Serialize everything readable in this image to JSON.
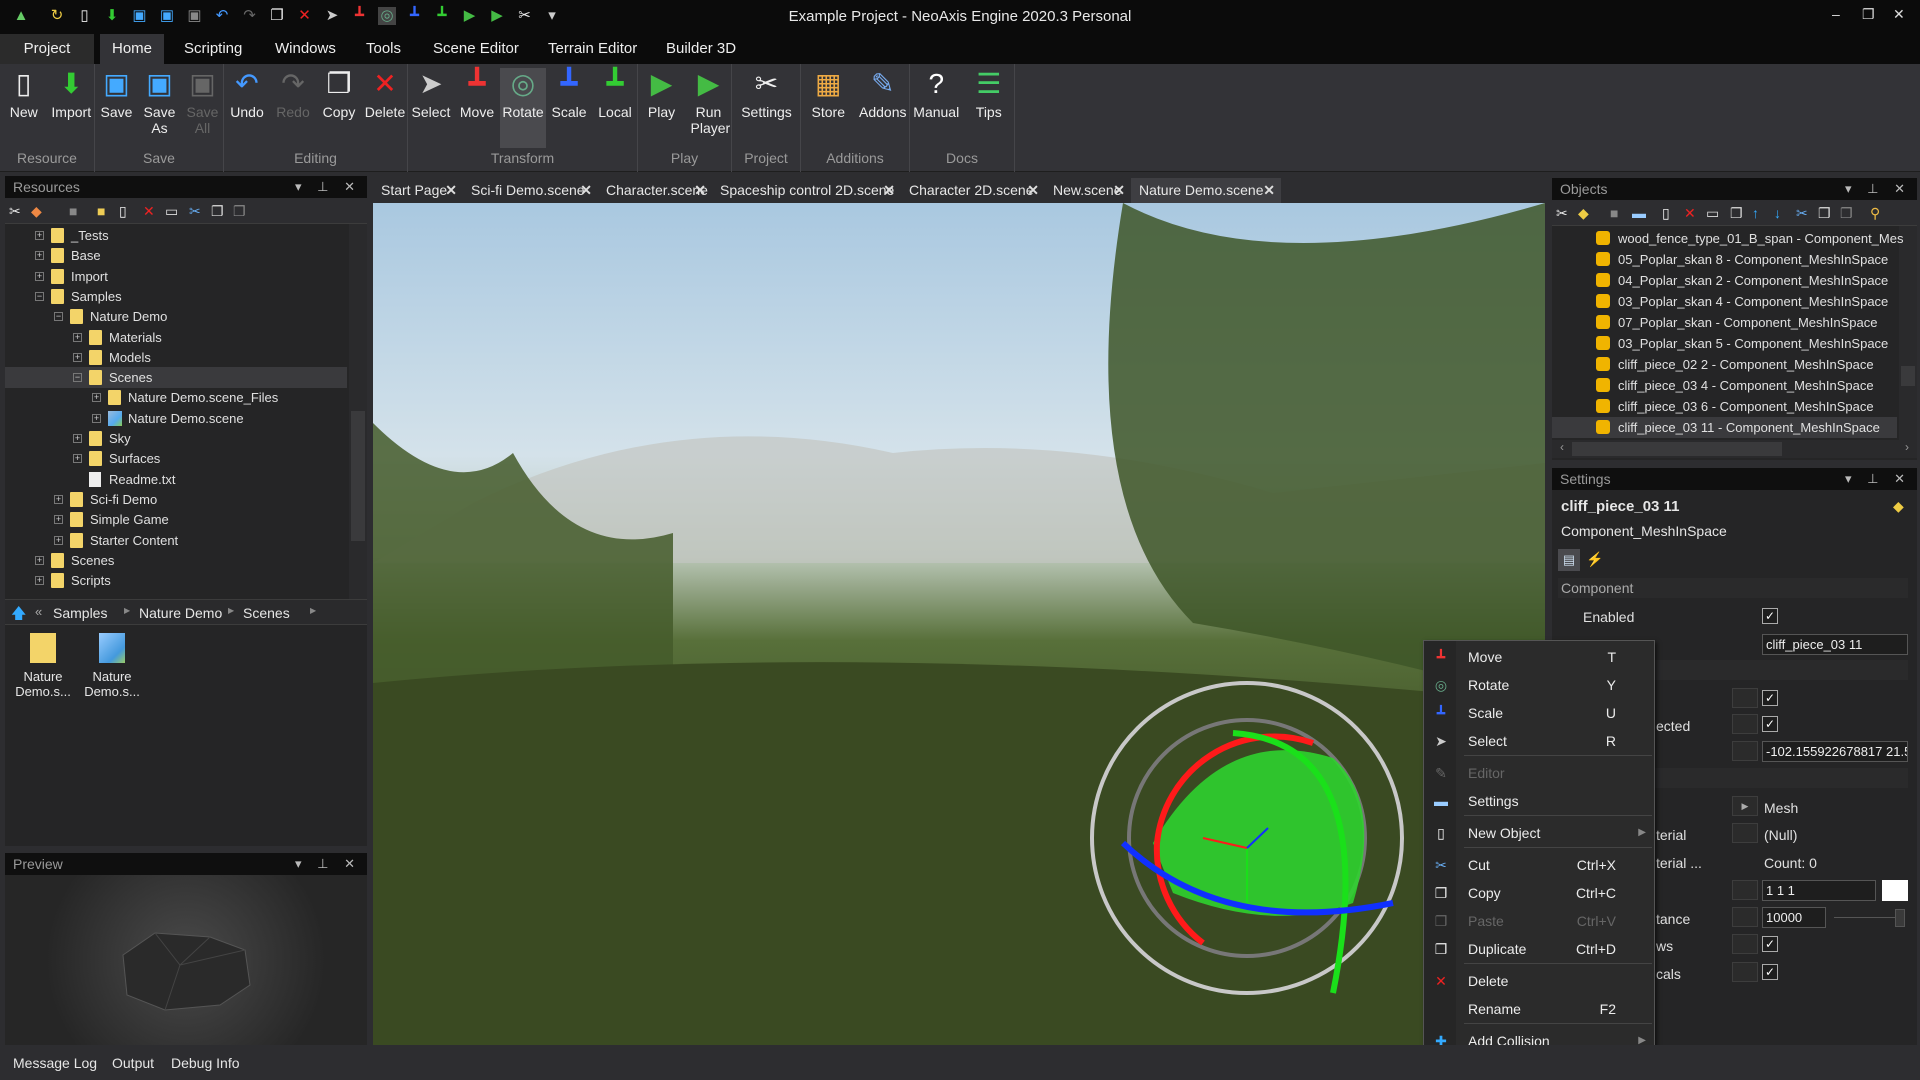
{
  "window": {
    "title": "Example Project - NeoAxis Engine 2020.3 Personal",
    "controls": [
      "–",
      "❐",
      "✕"
    ]
  },
  "ribbon_tabs": [
    "Project",
    "Home",
    "Scripting",
    "Windows",
    "Tools",
    "Scene Editor",
    "Terrain Editor",
    "Builder 3D"
  ],
  "ribbon_groups": [
    {
      "label": "Resource",
      "buttons": [
        {
          "label": "New",
          "icon": "new-file-icon"
        },
        {
          "label": "Import",
          "icon": "import-icon"
        }
      ]
    },
    {
      "label": "Save",
      "buttons": [
        {
          "label": "Save",
          "icon": "save-icon"
        },
        {
          "label": "Save As",
          "icon": "save-as-icon"
        },
        {
          "label": "Save All",
          "icon": "save-all-icon",
          "disabled": true
        }
      ]
    },
    {
      "label": "Editing",
      "buttons": [
        {
          "label": "Undo",
          "icon": "undo-icon"
        },
        {
          "label": "Redo",
          "icon": "redo-icon",
          "disabled": true
        },
        {
          "label": "Copy",
          "icon": "copy-icon"
        },
        {
          "label": "Delete",
          "icon": "delete-icon"
        }
      ]
    },
    {
      "label": "Transform",
      "buttons": [
        {
          "label": "Select",
          "icon": "select-icon"
        },
        {
          "label": "Move",
          "icon": "move-icon"
        },
        {
          "label": "Rotate",
          "icon": "rotate-icon",
          "selected": true
        },
        {
          "label": "Scale",
          "icon": "scale-icon"
        },
        {
          "label": "Local",
          "icon": "local-icon"
        }
      ]
    },
    {
      "label": "Play",
      "buttons": [
        {
          "label": "Play",
          "icon": "play-icon"
        },
        {
          "label": "Run Player",
          "icon": "run-player-icon"
        }
      ]
    },
    {
      "label": "Project",
      "buttons": [
        {
          "label": "Settings",
          "icon": "settings-icon"
        }
      ]
    },
    {
      "label": "Additions",
      "buttons": [
        {
          "label": "Store",
          "icon": "store-icon"
        },
        {
          "label": "Addons",
          "icon": "addons-icon"
        }
      ]
    },
    {
      "label": "Docs",
      "buttons": [
        {
          "label": "Manual",
          "icon": "help-icon"
        },
        {
          "label": "Tips",
          "icon": "tips-icon"
        }
      ]
    }
  ],
  "resources": {
    "title": "Resources",
    "tree": [
      {
        "label": "_Tests",
        "level": 0,
        "exp": "+",
        "type": "folder"
      },
      {
        "label": "Base",
        "level": 0,
        "exp": "+",
        "type": "folder"
      },
      {
        "label": "Import",
        "level": 0,
        "exp": "+",
        "type": "folder"
      },
      {
        "label": "Samples",
        "level": 0,
        "exp": "−",
        "type": "folder"
      },
      {
        "label": "Nature Demo",
        "level": 1,
        "exp": "−",
        "type": "folder"
      },
      {
        "label": "Materials",
        "level": 2,
        "exp": "+",
        "type": "folder"
      },
      {
        "label": "Models",
        "level": 2,
        "exp": "+",
        "type": "folder"
      },
      {
        "label": "Scenes",
        "level": 2,
        "exp": "−",
        "type": "folder",
        "selected": true
      },
      {
        "label": "Nature Demo.scene_Files",
        "level": 3,
        "exp": "+",
        "type": "folder"
      },
      {
        "label": "Nature Demo.scene",
        "level": 3,
        "exp": "+",
        "type": "scene"
      },
      {
        "label": "Sky",
        "level": 2,
        "exp": "+",
        "type": "folder"
      },
      {
        "label": "Surfaces",
        "level": 2,
        "exp": "+",
        "type": "folder"
      },
      {
        "label": "Readme.txt",
        "level": 2,
        "exp": "",
        "type": "file"
      },
      {
        "label": "Sci-fi Demo",
        "level": 1,
        "exp": "+",
        "type": "folder"
      },
      {
        "label": "Simple Game",
        "level": 1,
        "exp": "+",
        "type": "folder"
      },
      {
        "label": "Starter Content",
        "level": 1,
        "exp": "+",
        "type": "folder"
      },
      {
        "label": "Scenes",
        "level": 0,
        "exp": "+",
        "type": "folder"
      },
      {
        "label": "Scripts",
        "level": 0,
        "exp": "+",
        "type": "folder"
      }
    ],
    "breadcrumb": [
      "Samples",
      "Nature Demo",
      "Scenes"
    ],
    "files": [
      {
        "label1": "Nature",
        "label2": "Demo.s...",
        "type": "folder"
      },
      {
        "label1": "Nature",
        "label2": "Demo.s...",
        "type": "scene"
      }
    ]
  },
  "preview": {
    "title": "Preview"
  },
  "doc_tabs": [
    {
      "label": "Start Page"
    },
    {
      "label": "Sci-fi Demo.scene"
    },
    {
      "label": "Character.scene"
    },
    {
      "label": "Spaceship control 2D.scene"
    },
    {
      "label": "Character 2D.scene"
    },
    {
      "label": "New.scene"
    },
    {
      "label": "Nature Demo.scene",
      "active": true
    }
  ],
  "objects": {
    "title": "Objects",
    "items": [
      "wood_fence_type_01_B_span - Component_Mes",
      "05_Poplar_skan 8 - Component_MeshInSpace",
      "04_Poplar_skan 2 - Component_MeshInSpace",
      "03_Poplar_skan 4 - Component_MeshInSpace",
      "07_Poplar_skan - Component_MeshInSpace",
      "03_Poplar_skan 5 - Component_MeshInSpace",
      "cliff_piece_02 2 - Component_MeshInSpace",
      "cliff_piece_03 4 - Component_MeshInSpace",
      "cliff_piece_03 6 - Component_MeshInSpace",
      "cliff_piece_03 11 - Component_MeshInSpace"
    ],
    "selected_index": 9
  },
  "settings": {
    "title": "Settings",
    "object_name": "cliff_piece_03 11",
    "object_type": "Component_MeshInSpace",
    "group_component": "Component",
    "enabled_label": "Enabled",
    "name_value": "cliff_piece_03 11",
    "selected_label_fragment": "ected",
    "transform_value": "-102.155922678817 21.5",
    "mesh_value": "Mesh",
    "material_label_fragment": "terial",
    "material_value": "(Null)",
    "material2_label_fragment": "terial ...",
    "material2_value": "Count: 0",
    "color_value": "1 1 1",
    "distance_label_fragment": "tance",
    "distance_value": "10000",
    "shadows_label_fragment": "ws",
    "decals_label_fragment": "cals"
  },
  "context_menu": {
    "items": [
      {
        "label": "Move",
        "shortcut": "T",
        "icon": "move-icon"
      },
      {
        "label": "Rotate",
        "shortcut": "Y",
        "icon": "rotate-icon"
      },
      {
        "label": "Scale",
        "shortcut": "U",
        "icon": "scale-icon"
      },
      {
        "label": "Select",
        "shortcut": "R",
        "icon": "select-icon"
      },
      {
        "label": "Editor",
        "shortcut": "",
        "icon": "editor-icon",
        "disabled": true
      },
      {
        "label": "Settings",
        "shortcut": "",
        "icon": "settings-window-icon"
      },
      {
        "label": "New Object",
        "shortcut": "",
        "icon": "new-object-icon",
        "submenu": true
      },
      {
        "label": "Cut",
        "shortcut": "Ctrl+X",
        "icon": "cut-icon"
      },
      {
        "label": "Copy",
        "shortcut": "Ctrl+C",
        "icon": "copy-icon"
      },
      {
        "label": "Paste",
        "shortcut": "Ctrl+V",
        "icon": "paste-icon",
        "disabled": true
      },
      {
        "label": "Duplicate",
        "shortcut": "Ctrl+D",
        "icon": "duplicate-icon"
      },
      {
        "label": "Delete",
        "shortcut": "",
        "icon": "delete-icon"
      },
      {
        "label": "Rename",
        "shortcut": "F2",
        "icon": ""
      },
      {
        "label": "Add Collision",
        "shortcut": "",
        "icon": "add-icon",
        "submenu": true
      }
    ]
  },
  "statusbar": [
    "Message Log",
    "Output",
    "Debug Info"
  ],
  "colors": {
    "accent_selected": "#4a4a4e",
    "title_bg": "#0b0b0b",
    "panel_bg": "#252526",
    "gizmo_x": "#ff2020",
    "gizmo_y": "#20e020",
    "gizmo_z": "#1030ff"
  }
}
